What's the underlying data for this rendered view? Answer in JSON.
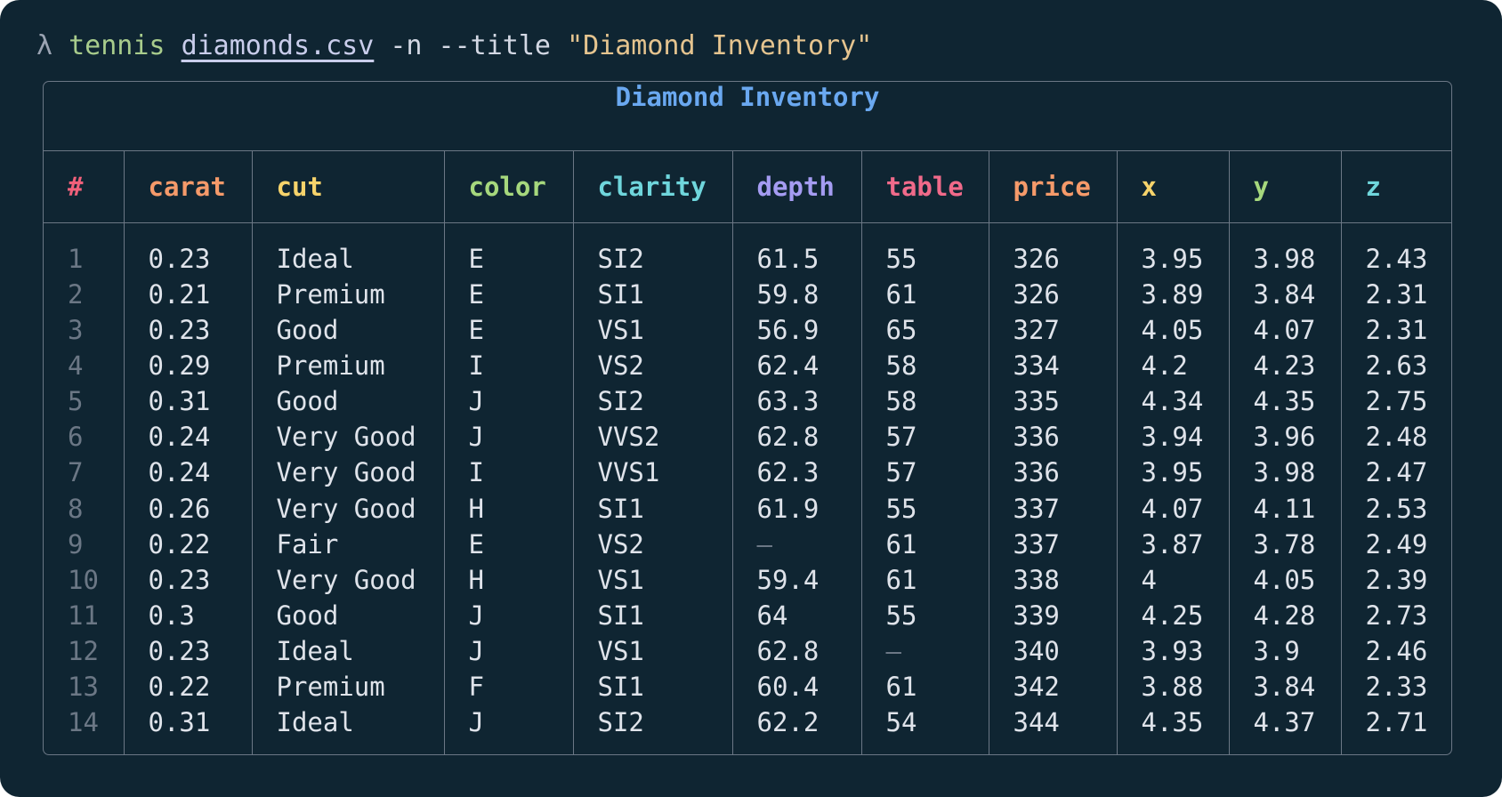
{
  "command": {
    "prompt": "λ",
    "program": "tennis",
    "file": "diamonds.csv",
    "flags": "-n --title",
    "title_arg": "\"Diamond Inventory\""
  },
  "table": {
    "title": "Diamond Inventory",
    "columns": [
      {
        "label": "#",
        "color": "#f0607a"
      },
      {
        "label": "carat",
        "color": "#f59a6a"
      },
      {
        "label": "cut",
        "color": "#f6d36b"
      },
      {
        "label": "color",
        "color": "#a6d87d"
      },
      {
        "label": "clarity",
        "color": "#6fd6dc"
      },
      {
        "label": "depth",
        "color": "#a59cf2"
      },
      {
        "label": "table",
        "color": "#f06a8a"
      },
      {
        "label": "price",
        "color": "#f59a6a"
      },
      {
        "label": "x",
        "color": "#f6d36b"
      },
      {
        "label": "y",
        "color": "#a6d87d"
      },
      {
        "label": "z",
        "color": "#6fd6dc"
      }
    ],
    "rows": [
      [
        "1",
        "0.23",
        "Ideal",
        "E",
        "SI2",
        "61.5",
        "55",
        "326",
        "3.95",
        "3.98",
        "2.43"
      ],
      [
        "2",
        "0.21",
        "Premium",
        "E",
        "SI1",
        "59.8",
        "61",
        "326",
        "3.89",
        "3.84",
        "2.31"
      ],
      [
        "3",
        "0.23",
        "Good",
        "E",
        "VS1",
        "56.9",
        "65",
        "327",
        "4.05",
        "4.07",
        "2.31"
      ],
      [
        "4",
        "0.29",
        "Premium",
        "I",
        "VS2",
        "62.4",
        "58",
        "334",
        "4.2",
        "4.23",
        "2.63"
      ],
      [
        "5",
        "0.31",
        "Good",
        "J",
        "SI2",
        "63.3",
        "58",
        "335",
        "4.34",
        "4.35",
        "2.75"
      ],
      [
        "6",
        "0.24",
        "Very Good",
        "J",
        "VVS2",
        "62.8",
        "57",
        "336",
        "3.94",
        "3.96",
        "2.48"
      ],
      [
        "7",
        "0.24",
        "Very Good",
        "I",
        "VVS1",
        "62.3",
        "57",
        "336",
        "3.95",
        "3.98",
        "2.47"
      ],
      [
        "8",
        "0.26",
        "Very Good",
        "H",
        "SI1",
        "61.9",
        "55",
        "337",
        "4.07",
        "4.11",
        "2.53"
      ],
      [
        "9",
        "0.22",
        "Fair",
        "E",
        "VS2",
        "—",
        "61",
        "337",
        "3.87",
        "3.78",
        "2.49"
      ],
      [
        "10",
        "0.23",
        "Very Good",
        "H",
        "VS1",
        "59.4",
        "61",
        "338",
        "4",
        "4.05",
        "2.39"
      ],
      [
        "11",
        "0.3",
        "Good",
        "J",
        "SI1",
        "64",
        "55",
        "339",
        "4.25",
        "4.28",
        "2.73"
      ],
      [
        "12",
        "0.23",
        "Ideal",
        "J",
        "VS1",
        "62.8",
        "—",
        "340",
        "3.93",
        "3.9",
        "2.46"
      ],
      [
        "13",
        "0.22",
        "Premium",
        "F",
        "SI1",
        "60.4",
        "61",
        "342",
        "3.88",
        "3.84",
        "2.33"
      ],
      [
        "14",
        "0.31",
        "Ideal",
        "J",
        "SI2",
        "62.2",
        "54",
        "344",
        "4.35",
        "4.37",
        "2.71"
      ]
    ],
    "null_color": "#6b7785"
  }
}
